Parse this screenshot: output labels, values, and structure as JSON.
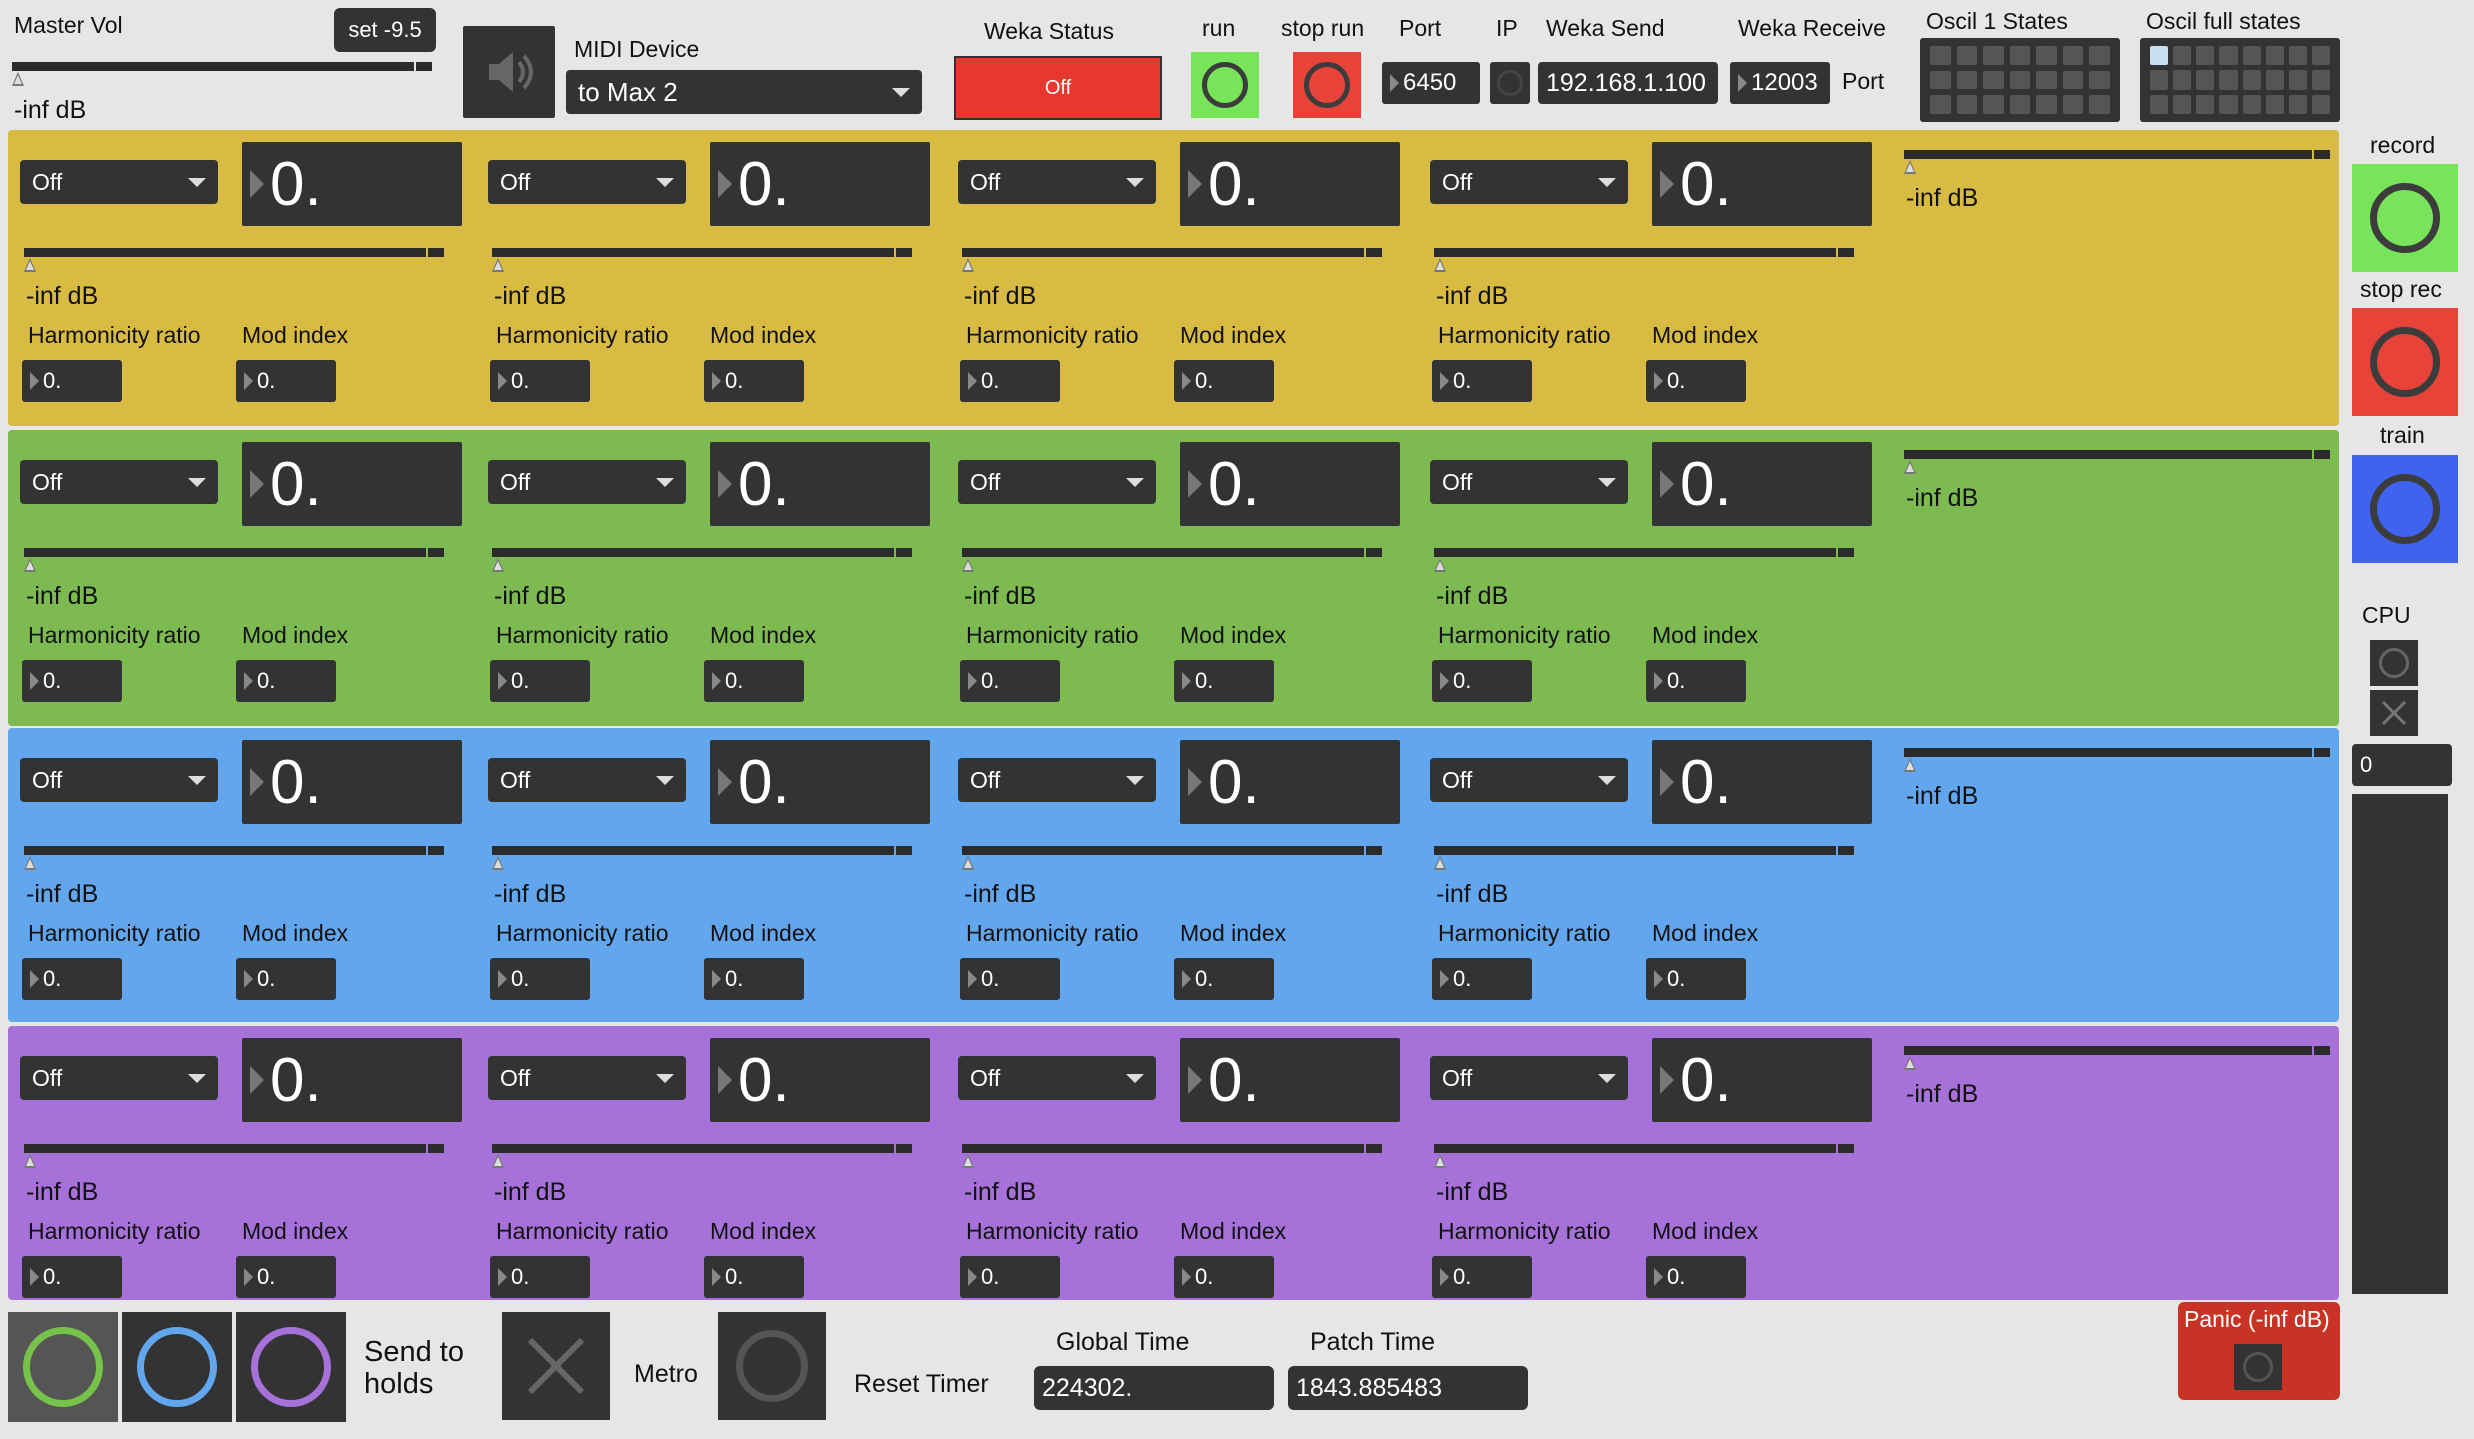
{
  "header": {
    "master_vol_label": "Master Vol",
    "set_button": "set -9.5",
    "master_db": "-inf dB",
    "midi_device_label": "MIDI Device",
    "midi_device_value": "to Max 2",
    "weka_status_label": "Weka Status",
    "weka_status_value": "Off",
    "run_label": "run",
    "stop_run_label": "stop run",
    "port_label": "Port",
    "port_value": "6450",
    "ip_label": "IP",
    "weka_send_label": "Weka Send",
    "weka_send_value": "192.168.1.100",
    "weka_receive_label": "Weka Receive",
    "weka_receive_value": "12003",
    "receive_port_label": "Port",
    "oscil1_label": "Oscil 1 States",
    "oscil_full_label": "Oscil full states"
  },
  "side": {
    "record_label": "record",
    "stop_rec_label": "stop rec",
    "train_label": "train",
    "cpu_label": "CPU",
    "cpu_value": "0",
    "panic_label": "Panic (-inf dB)"
  },
  "colors": {
    "yellow": "#d8bb43",
    "green": "#7dbb52",
    "blue": "#62a6ee",
    "purple": "#a671d8",
    "record": "#77e45a",
    "stop": "#e84338",
    "train": "#3d63ef",
    "weka_off": "#e8372e",
    "panic": "#c93326"
  },
  "voice": {
    "menu_value": "Off",
    "number_value": "0.",
    "db_value": "-inf dB",
    "harmonicity_label": "Harmonicity ratio",
    "mod_label": "Mod index",
    "small_value": "0."
  },
  "panel_db": "-inf dB",
  "footer": {
    "send_to_holds": "Send to holds",
    "metro_label": "Metro",
    "reset_timer_label": "Reset Timer",
    "global_time_label": "Global Time",
    "global_time_value": "224302.",
    "patch_time_label": "Patch Time",
    "patch_time_value": "1843.885483"
  }
}
